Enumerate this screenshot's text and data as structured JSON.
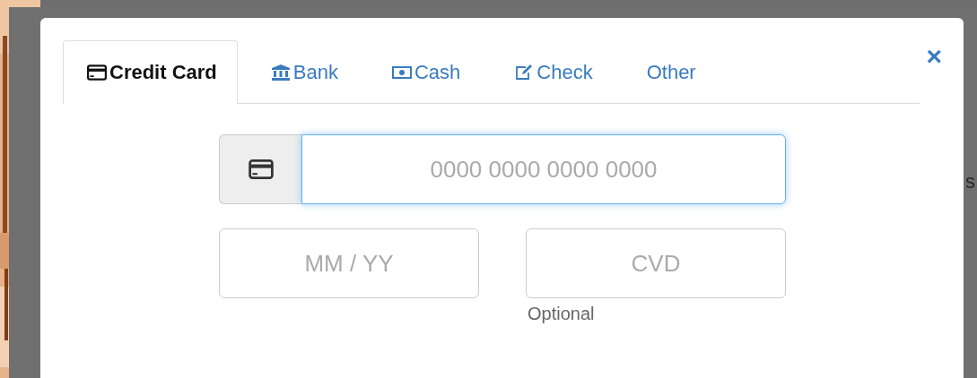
{
  "background_text": "s",
  "tabs": [
    {
      "label": "Credit Card",
      "kind": "card",
      "selected": true
    },
    {
      "label": "Bank",
      "kind": "bank",
      "selected": false
    },
    {
      "label": "Cash",
      "kind": "cash",
      "selected": false
    },
    {
      "label": "Check",
      "kind": "check",
      "selected": false
    },
    {
      "label": "Other",
      "kind": "plain",
      "selected": false
    }
  ],
  "close": "×",
  "card_number": {
    "placeholder": "0000 0000 0000 0000",
    "focused": true
  },
  "expiry": {
    "placeholder": "MM / YY",
    "focused": false
  },
  "cvd": {
    "placeholder": "CVD",
    "focused": false,
    "hint": "Optional"
  }
}
